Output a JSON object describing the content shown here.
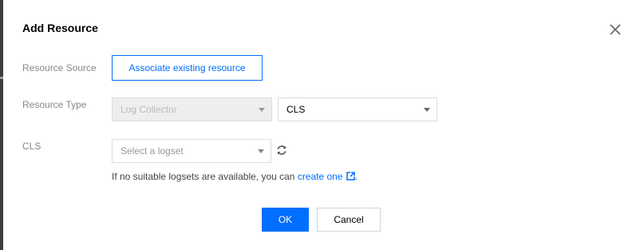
{
  "dialog": {
    "title": "Add Resource",
    "close_icon": "close-icon"
  },
  "form": {
    "resource_source": {
      "label": "Resource Source",
      "button_label": "Associate existing resource"
    },
    "resource_type": {
      "label": "Resource Type",
      "type_select_value": "Log Collector",
      "type_select_disabled": true,
      "service_select_value": "CLS"
    },
    "cls": {
      "label": "CLS",
      "logset_placeholder": "Select a logset",
      "refresh_icon": "refresh-icon",
      "hint_text": "If no suitable logsets are available, you can ",
      "hint_link": "create one",
      "hint_link_icon": "external-link-icon",
      "hint_suffix": "."
    }
  },
  "footer": {
    "ok_label": "OK",
    "cancel_label": "Cancel"
  },
  "colors": {
    "accent": "#006eff",
    "label": "#888888",
    "border": "#dddddd",
    "disabled_bg": "#eeeeee"
  }
}
